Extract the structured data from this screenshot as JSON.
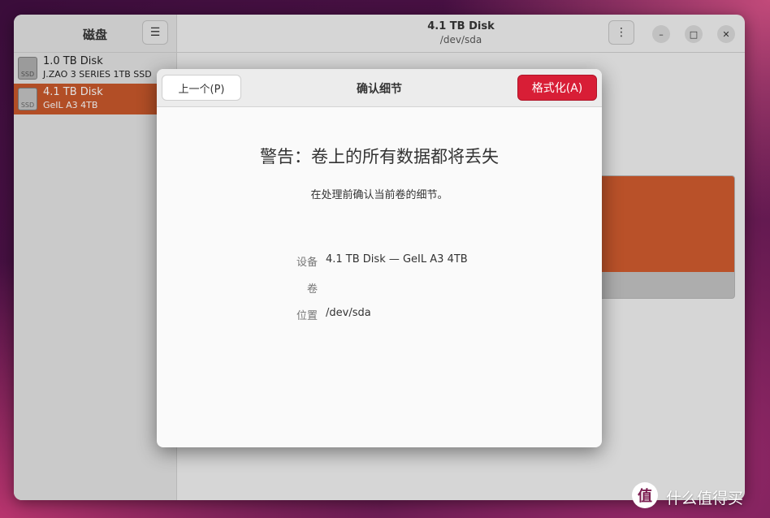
{
  "sidebar": {
    "title": "磁盘",
    "menu_icon": "hamburger-menu-icon",
    "disks": [
      {
        "name": "1.0 TB Disk",
        "model": "J.ZAO 3 SERIES 1TB SSD",
        "icon_label": "SSD",
        "selected": false
      },
      {
        "name": "4.1 TB Disk",
        "model": "GeIL A3 4TB",
        "icon_label": "SSD",
        "selected": true
      }
    ]
  },
  "main": {
    "title": "4.1 TB Disk",
    "subtitle": "/dev/sda",
    "more_icon": "vertical-dots-icon",
    "window_controls": {
      "minimize": "–",
      "maximize": "□",
      "close": "✕"
    },
    "partition_color": "#c9582d"
  },
  "dialog": {
    "back_label": "上一个(P)",
    "title": "确认细节",
    "format_label": "格式化(A)",
    "warning_title": "警告：卷上的所有数据都将丢失",
    "warning_sub": "在处理前确认当前卷的细节。",
    "details": [
      {
        "label": "设备",
        "value": "4.1 TB Disk — GeIL A3 4TB"
      },
      {
        "label": "卷",
        "value": ""
      },
      {
        "label": "位置",
        "value": "/dev/sda"
      }
    ],
    "accent_color": "#d81e36"
  },
  "watermark": {
    "glyph": "值",
    "text": "什么值得买"
  }
}
